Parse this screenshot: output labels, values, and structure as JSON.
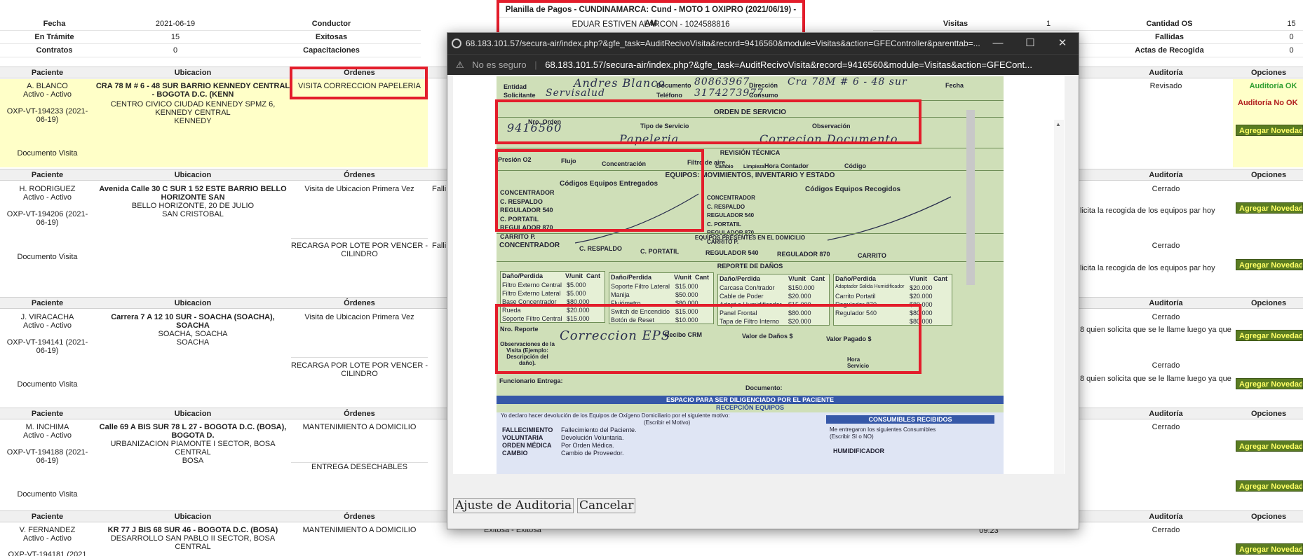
{
  "header": {
    "title": "Planilla de Pagos - CUNDINAMARCA: Cund - MOTO 1 OXIPRO (2021/06/19) - AM",
    "subtitle": "EDUAR ESTIVEN ALARCON - 1024588816"
  },
  "summary": {
    "fecha_label": "Fecha",
    "fecha_value": "2021-06-19",
    "conductor_label": "Conductor",
    "tramite_label": "En Trámite",
    "tramite_value": "15",
    "exitosas_label": "Exitosas",
    "contratos_label": "Contratos",
    "contratos_value": "0",
    "capacitaciones_label": "Capacitaciones",
    "visitas_label": "Visitas",
    "visitas_value": "1",
    "cantidad_os_label": "Cantidad OS",
    "cantidad_os_value": "15",
    "fallidas_label": "Fallidas",
    "fallidas_value": "0",
    "actas_label": "Actas de Recogida",
    "actas_value": "0"
  },
  "columns": {
    "paciente": "Paciente",
    "ubicacion": "Ubicacion",
    "ordenes": "Órdenes",
    "auditoria": "Auditoría",
    "opciones": "Opciones"
  },
  "records": [
    {
      "name": "A. BLANCO",
      "status": "Activo - Activo",
      "code": "OXP-VT-194233 (2021-06-19)",
      "doc": "Documento Visita",
      "address": "CRA 78 M # 6 - 48 SUR BARRIO KENNEDY CENTRAL - BOGOTA D.C. (KENN",
      "address2": "CENTRO CIVICO CIUDAD KENNEDY SPMZ 6, KENNEDY CENTRAL",
      "locality": "KENNEDY",
      "orders": [
        "VISITA CORRECCION PAPELERIA"
      ],
      "audit": [
        "Revisado"
      ],
      "audit_ok": "Auditoría OK",
      "audit_no": "Auditoría No OK"
    },
    {
      "name": "H. RODRIGUEZ",
      "status": "Activo - Activo",
      "code": "OXP-VT-194206 (2021-06-19)",
      "doc": "Documento Visita",
      "address": "Avenida Calle 30 C SUR 1 52 ESTE BARRIO BELLO HORIZONTE SAN",
      "address2": "BELLO HORIZONTE, 20 DE JULIO",
      "locality": "SAN CRISTOBAL",
      "orders": [
        "Visita de Ubicacion Primera Vez",
        "RECARGA POR LOTE POR VENCER - CILINDRO"
      ],
      "result": "Falli",
      "audit": [
        "Cerrado",
        "Cerrado"
      ],
      "notes": [
        "licita la recogida de los equipos par hoy",
        "licita la recogida de los equipos par hoy"
      ]
    },
    {
      "name": "J. VIRACACHA",
      "status": "Activo - Activo",
      "code": "OXP-VT-194141 (2021-06-19)",
      "doc": "Documento Visita",
      "address": "Carrera 7 A 12 10 SUR - SOACHA (SOACHA), SOACHA",
      "address2": "SOACHA, SOACHA",
      "locality": "SOACHA",
      "orders": [
        "Visita de Ubicacion Primera Vez",
        "RECARGA POR LOTE POR VENCER - CILINDRO"
      ],
      "audit": [
        "Cerrado",
        "Cerrado"
      ],
      "notes": [
        "8 quien solicita que se le llame luego ya que",
        "8 quien solicita que se le llame luego ya que"
      ]
    },
    {
      "name": "M. INCHIMA",
      "status": "Activo - Activo",
      "code": "OXP-VT-194188 (2021-06-19)",
      "doc": "Documento Visita",
      "address": "Calle 69 A BIS SUR 78 L 27 - BOGOTA D.C. (BOSA), BOGOTA D.",
      "address2": "URBANIZACION PIAMONTE I SECTOR, BOSA CENTRAL",
      "locality": "BOSA",
      "orders": [
        "MANTENIMIENTO A DOMICILIO",
        "ENTREGA DESECHABLES"
      ],
      "audit": [
        "Cerrado"
      ]
    },
    {
      "name": "V. FERNANDEZ",
      "status": "Activo - Activo",
      "code": "OXP-VT-194181 (2021",
      "address": "KR 77 J BIS 68 SUR 46 - BOGOTA D.C. (BOSA)",
      "address2": "DESARROLLO SAN PABLO II SECTOR, BOSA",
      "locality": "CENTRAL",
      "orders": [
        "MANTENIMIENTO A DOMICILIO"
      ],
      "result": "Exitosa - Exitosa",
      "time": "09:23",
      "audit": [
        "Cerrado"
      ]
    }
  ],
  "add_button": "Agregar Novedad",
  "popup": {
    "title": "68.183.101.57/secura-air/index.php?&gfe_task=AuditRecivoVisita&record=9416560&module=Visitas&action=GFEController&parenttab=...",
    "not_secure": "No es seguro",
    "url": "68.183.101.57/secura-air/index.php?&gfe_task=AuditRecivoVisita&record=9416560&module=Visitas&action=GFECont...",
    "btn_adjust": "Ajuste de Auditoria",
    "btn_cancel": "Cancelar",
    "doc": {
      "entidad": "Entidad",
      "solicitante": "Solicitante",
      "documento": "Documento",
      "telefono": "Teléfono",
      "direccion": "Dirección",
      "consumo": "Consumo",
      "fecha": "Fecha",
      "hw_entidad": "Andres Blanco",
      "hw_solicit": "Servisalud",
      "hw_doc": "80863967",
      "hw_tel": "3174273977",
      "hw_dir": "Cra 78M # 6 - 48 sur",
      "orden_servicio": "ORDEN DE SERVICIO",
      "nro_orden": "Nro. Orden",
      "tipo_servicio": "Tipo de Servicio",
      "observacion": "Observación",
      "hw_orden": "9416560",
      "hw_tipo": "Papeleria",
      "hw_obs": "Correcion Documento",
      "revision": "REVISIÓN TÉCNICA",
      "presion": "Presión O2",
      "flujo": "Flujo",
      "concentracion": "Concentración",
      "filtro_aire": "Filtro de aire",
      "cambio": "Cambio",
      "limpieza": "Limpieza",
      "hora_contador": "Hora Contador",
      "codigo": "Código",
      "equipos_title": "EQUIPOS: MOVIMIENTOS, INVENTARIO Y ESTADO",
      "entregados": "Códigos Equipos Entregados",
      "recogidos": "Códigos Equipos Recogidos",
      "equip_list": [
        "CONCENTRADOR",
        "C. RESPALDO",
        "REGULADOR 540",
        "C. PORTATIL",
        "REGULADOR 870",
        "CARRITO P."
      ],
      "presentes": "EQUIPOS PRESENTES EN EL DOMICILIO",
      "present_list": [
        "CONCENTRADOR",
        "C. RESPALDO",
        "C. PORTATIL",
        "REGULADOR 540",
        "REGULADOR 870",
        "CARRITO"
      ],
      "danos_title": "REPORTE DE DAÑOS",
      "danos_head": [
        "Daño/Perdida",
        "V/unit",
        "Cant"
      ],
      "danos_c1": [
        [
          "Filtro Externo Central",
          "$5.000"
        ],
        [
          "Filtro Externo Lateral",
          "$5.000"
        ],
        [
          "Base Concentrador",
          "$80.000"
        ],
        [
          "Rueda",
          "$20.000"
        ],
        [
          "Soporte Filtro Central",
          "$15.000"
        ]
      ],
      "danos_c2": [
        [
          "Soporte Filtro Lateral",
          "$15.000"
        ],
        [
          "Manija",
          "$50.000"
        ],
        [
          "Flujómetro",
          "$80.000"
        ],
        [
          "Switch de Encendido",
          "$15.000"
        ],
        [
          "Botón de Reset",
          "$10.000"
        ]
      ],
      "danos_c3": [
        [
          "Carcasa Con/trador",
          "$150.000"
        ],
        [
          "Cable de Poder",
          "$20.000"
        ],
        [
          "Adapt a Humidificador",
          "$15.000"
        ],
        [
          "Panel Frontal",
          "$80.000"
        ],
        [
          "Tapa de Filtro Interno",
          "$20.000"
        ]
      ],
      "danos_c4": [
        [
          "Adaptador Salida Humidificador",
          "$20.000"
        ],
        [
          "Carrito Portatil",
          "$20.000"
        ],
        [
          "Regulador 870",
          "$80.000"
        ],
        [
          "Regulador 540",
          "$80.000"
        ],
        [
          "",
          "$80.000"
        ]
      ],
      "nro_reporte": "Nro. Reporte",
      "recibo_crm": "Recibo CRM",
      "valor_danos": "Valor de Daños $",
      "valor_pagado": "Valor Pagado $",
      "obs_visita": "Observaciones de la Visita (Ejemplo: Descripción del daño).",
      "hw_obs_visita": "Correccion EPS",
      "hora_servicio": "Hora Servicio",
      "funcionario": "Funcionario Entrega:",
      "documento2": "Documento:",
      "espacio": "ESPACIO PARA SER DILIGENCIADO POR EL PACIENTE",
      "recepcion": "RECEPCIÓN EQUIPOS",
      "declaro": "Yo declaro hacer devolución de los Equipos de Oxígeno Domiciliario por el siguiente motivo:",
      "escribir": "(Escribir el Motivo)",
      "motivos": [
        [
          "FALLECIMIENTO",
          "Fallecimiento del Paciente."
        ],
        [
          "VOLUNTARIA",
          "Devolución Voluntaria."
        ],
        [
          "ORDEN MÉDICA",
          "Por Orden Médica."
        ],
        [
          "CAMBIO",
          "Cambio de Proveedor."
        ]
      ],
      "consumibles": "CONSUMIBLES RECIBIDOS",
      "me_entregaron": "Me entregaron los siguientes Consumibles",
      "si_no": "(Escribir SI o NO)",
      "humidificador": "HUMIDIFICADOR"
    }
  }
}
